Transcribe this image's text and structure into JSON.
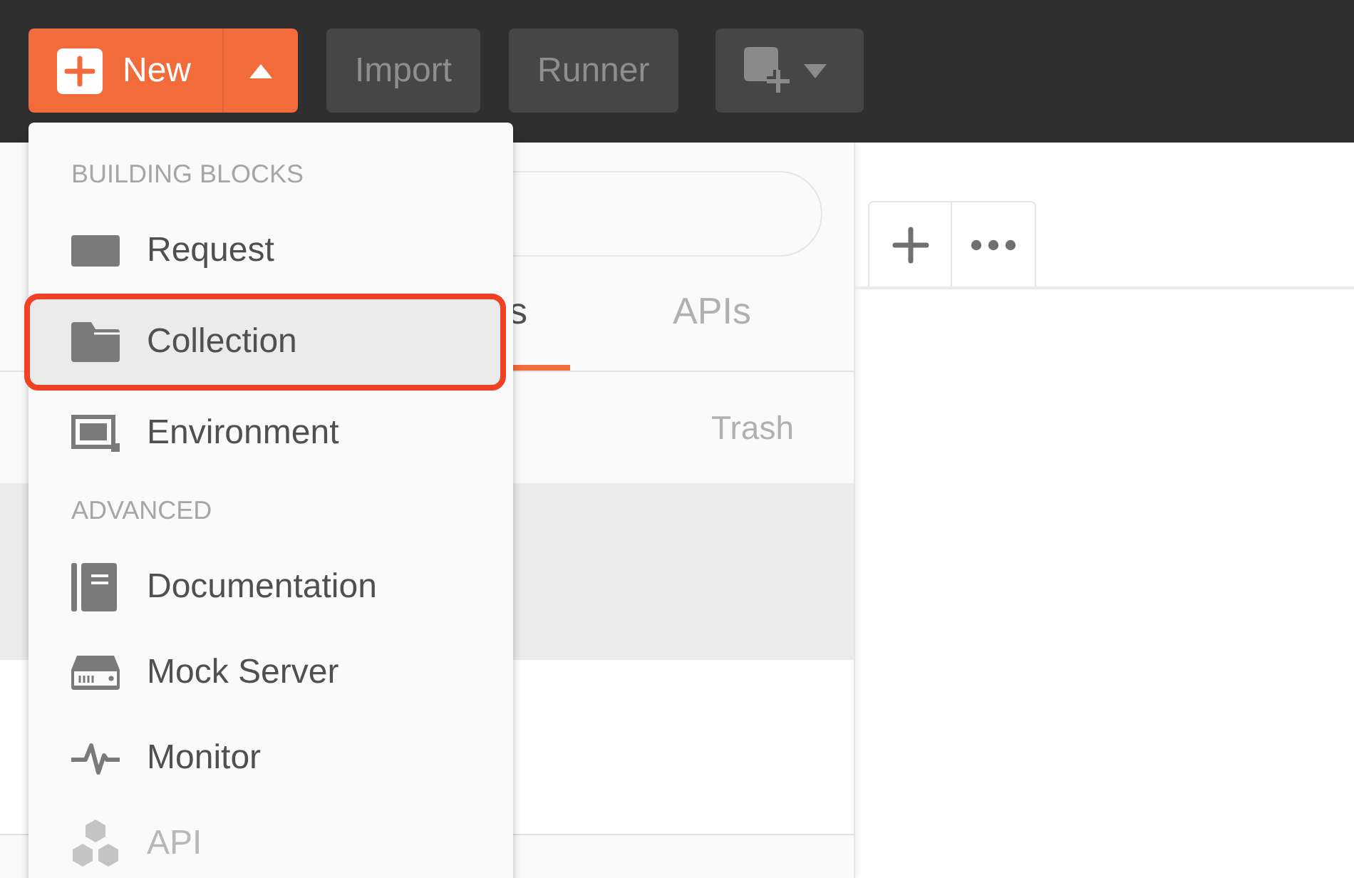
{
  "toolbar": {
    "new_button": {
      "label": "New"
    },
    "buttons": [
      {
        "label": "Import"
      },
      {
        "label": "Runner"
      }
    ]
  },
  "sidebar": {
    "tabs": [
      {
        "label": "s",
        "selected": true
      },
      {
        "label": "APIs",
        "selected": false
      }
    ],
    "trash": "Trash"
  },
  "menu": {
    "sections": [
      {
        "heading": "BUILDING BLOCKS",
        "items": [
          {
            "label": "Request",
            "kind": "request",
            "selected": false,
            "disabled": false,
            "outlined": false
          },
          {
            "label": "Collection",
            "kind": "collection",
            "selected": true,
            "disabled": false,
            "outlined": true
          },
          {
            "label": "Environment",
            "kind": "environment",
            "selected": false,
            "disabled": false,
            "outlined": false
          }
        ]
      },
      {
        "heading": "ADVANCED",
        "items": [
          {
            "label": "Documentation",
            "kind": "documentation",
            "selected": false,
            "disabled": false,
            "outlined": false
          },
          {
            "label": "Mock Server",
            "kind": "mock",
            "selected": false,
            "disabled": false,
            "outlined": false
          },
          {
            "label": "Monitor",
            "kind": "monitor",
            "selected": false,
            "disabled": false,
            "outlined": false
          },
          {
            "label": "API",
            "kind": "api",
            "selected": false,
            "disabled": true,
            "outlined": false
          }
        ]
      }
    ]
  }
}
